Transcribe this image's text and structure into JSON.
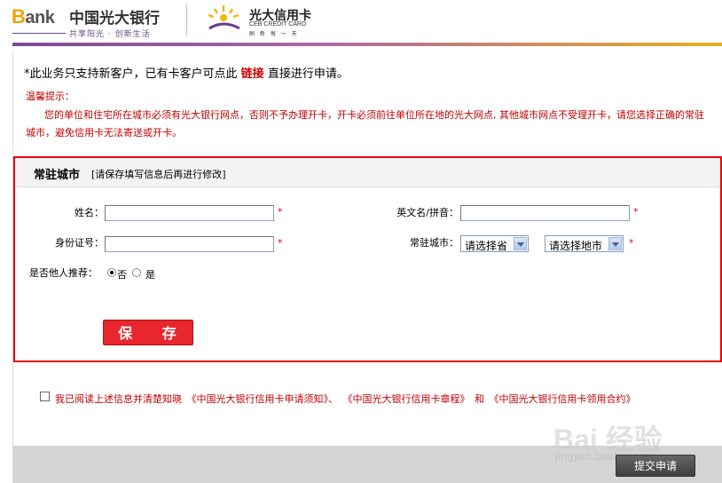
{
  "header": {
    "bank_logo_b": "B",
    "bank_logo_rest": "ank",
    "bank_name": "中国光大银行",
    "bank_slogan": "共享阳光 · 创新生活",
    "card_name": "光大信用卡",
    "card_en": "CEB CREDIT CARD",
    "card_sub": "刷 新 每 一 天"
  },
  "notice": {
    "prefix": "*此业务只支持新客户，已有卡客户可点此",
    "link": "链接",
    "suffix": "直接进行申请。"
  },
  "tip": {
    "title": "温馨提示：",
    "text": "您的单位和住宅所在城市必须有光大银行网点，否则不予办理开卡，开卡必须前往单位所在地的光大网点, 其他城市网点不受理开卡，请您选择正确的常驻城市，避免信用卡无法寄送或开卡。"
  },
  "form": {
    "title": "常驻城市",
    "hint": "[请保存填写信息后再进行修改]",
    "name_label": "姓名：",
    "english_name_label": "英文名/拼音：",
    "id_label": "身份证号：",
    "city_label": "常驻城市：",
    "province_select": "请选择省",
    "city_select": "请选择地市",
    "referral_label": "是否他人推荐：",
    "referral_no": "否",
    "referral_yes": "是",
    "required_mark": "*",
    "save_label": "保 存"
  },
  "agreement": {
    "text": "我已阅读上述信息并清楚知晓 《中国光大银行信用卡申请须知》、 《中国光大银行信用卡章程》 和 《中国光大银行信用卡领用合约》"
  },
  "submit_label": "提交申请",
  "watermark": {
    "main": "Bai 经验",
    "sub": "jingyan.baidu.com"
  },
  "colors": {
    "accent_red": "#e60012",
    "tip_red": "#c00000",
    "stripe_purple": "#7a4a9a",
    "stripe_gold": "#e8b020"
  }
}
